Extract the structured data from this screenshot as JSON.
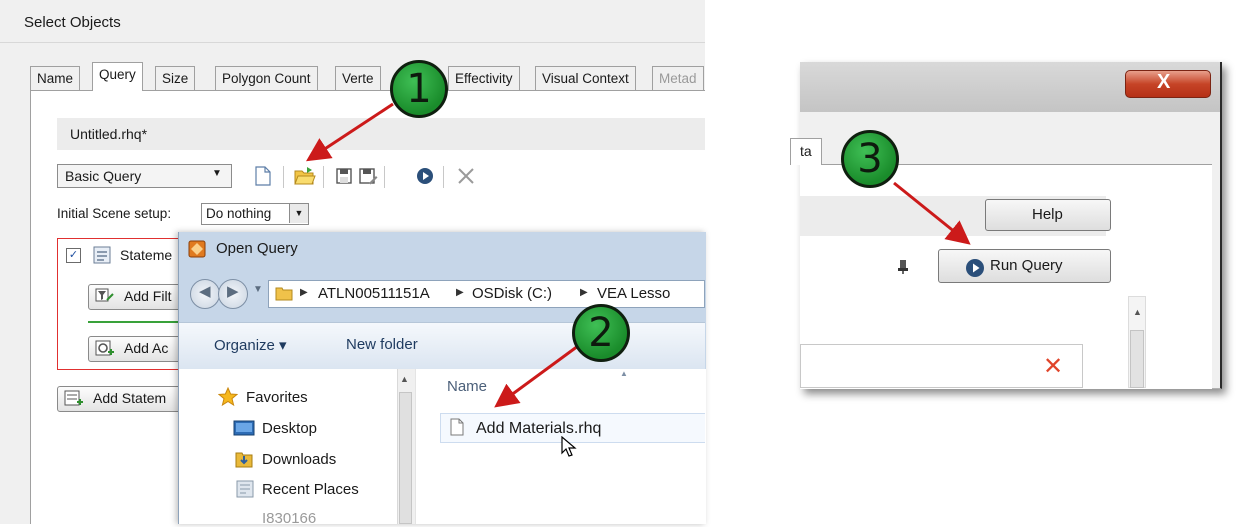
{
  "select_objects": {
    "title": "Select Objects",
    "tabs": [
      "Name",
      "Query",
      "Size",
      "Polygon Count",
      "Verte",
      "Effectivity",
      "Visual Context",
      "Metad"
    ],
    "active_tab": "Query",
    "file_name": "Untitled.rhq*",
    "query_type": "Basic Query",
    "toolbar_icons": [
      "new-file-icon",
      "open-folder-icon",
      "save-icon",
      "save-as-icon",
      "run-query-icon",
      "delete-icon"
    ],
    "initial_scene_label": "Initial Scene setup:",
    "initial_scene_value": "Do nothing",
    "statement_label": "Stateme",
    "add_filter_label": "Add Filt",
    "add_action_label": "Add Ac",
    "add_statement_label": "Add Statem"
  },
  "open_query": {
    "title": "Open Query",
    "breadcrumbs": [
      "ATLN00511151A",
      "OSDisk (C:)",
      "VEA Lesso"
    ],
    "organize_label": "Organize ▾",
    "new_folder_label": "New folder",
    "nav_items": [
      "Favorites",
      "Desktop",
      "Downloads",
      "Recent Places",
      "I830166"
    ],
    "column_header": "Name",
    "file_name": "Add Materials.rhq"
  },
  "query_window": {
    "tab_label": "ta",
    "close_label": "X",
    "help_label": "Help",
    "run_query_label": "Run Query"
  },
  "callouts": [
    "1",
    "2",
    "3"
  ],
  "colors": {
    "callout_green": "#1a8c2b",
    "arrow_red": "#cc1a1a",
    "statement_border": "#e03030"
  }
}
